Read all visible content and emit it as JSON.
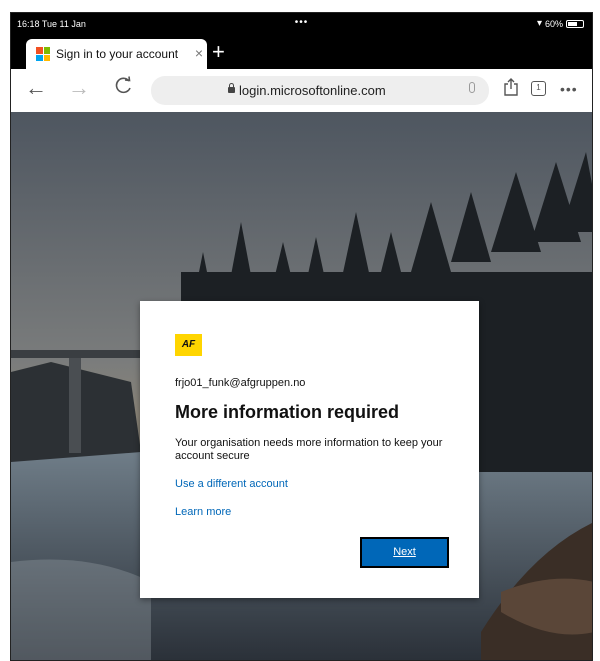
{
  "status_bar": {
    "time_date": "16:18  Tue 11 Jan",
    "dots": "•••",
    "battery": "60%"
  },
  "tab": {
    "title": "Sign in to your account",
    "close": "×",
    "new_tab": "+"
  },
  "toolbar": {
    "url": "login.microsoftonline.com",
    "tab_count": "1",
    "back": "←",
    "forward": "→",
    "reload": "C",
    "more": "•••"
  },
  "dialog": {
    "logo_text": "AF",
    "email": "frjo01_funk@afgruppen.no",
    "heading": "More information required",
    "description": "Your organisation needs more information to keep your account secure",
    "link_different_account": "Use a different account",
    "link_learn_more": "Learn more",
    "next_label": "Next"
  },
  "colors": {
    "accent": "#0067b8",
    "logo": "#ffd500"
  },
  "icons": [
    "back-icon",
    "forward-icon",
    "reload-icon",
    "lock-icon",
    "mic-icon",
    "share-icon",
    "tabs-icon",
    "more-icon",
    "wifi-icon",
    "battery-icon",
    "close-icon",
    "plus-icon"
  ]
}
